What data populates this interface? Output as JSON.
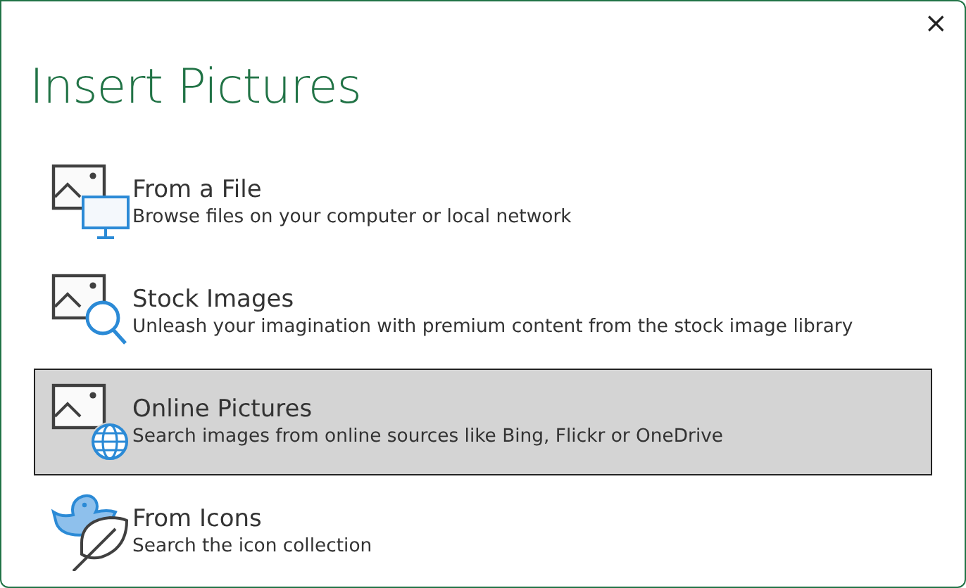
{
  "window": {
    "title": "Insert Pictures",
    "close": "×"
  },
  "options": [
    {
      "kind": "file",
      "title": "From a File",
      "description": "Browse files on your computer or local network",
      "selected": false
    },
    {
      "kind": "stock",
      "title": "Stock Images",
      "description": "Unleash your imagination with premium content from the stock image library",
      "selected": false
    },
    {
      "kind": "online",
      "title": "Online Pictures",
      "description": "Search images from online sources like Bing, Flickr or OneDrive",
      "selected": true
    },
    {
      "kind": "icons",
      "title": "From Icons",
      "description": "Search the icon collection",
      "selected": false
    }
  ]
}
